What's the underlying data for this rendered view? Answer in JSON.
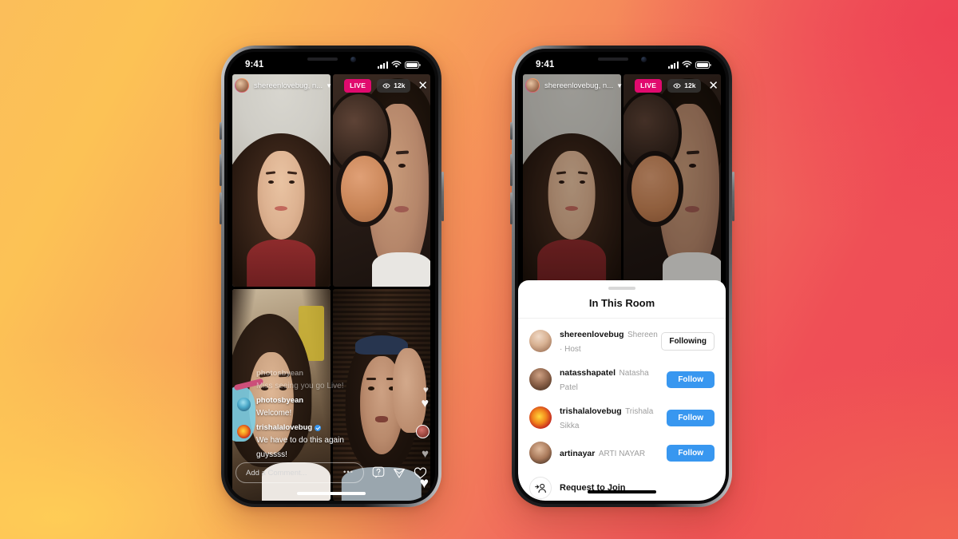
{
  "background": {
    "gradient_from": "#fbbe5a",
    "gradient_mid": "#f58a5a",
    "gradient_to": "#ee4a55"
  },
  "status_bar": {
    "time": "9:41",
    "signal_icon": "cellular-bars-icon",
    "wifi_icon": "wifi-icon",
    "battery_icon": "battery-icon"
  },
  "live": {
    "header": {
      "avatar_icon": "host-avatar",
      "title": "shereenlovebug, n...",
      "chevron_icon": "chevron-down-icon",
      "live_badge": "LIVE",
      "viewer_icon": "eye-icon",
      "viewer_count": "12k",
      "close_icon": "close-icon"
    },
    "comments": [
      {
        "user": "photosbyean",
        "text": "Miss seeing you go Live!",
        "verified": false,
        "faded": true
      },
      {
        "user": "photosbyean",
        "text": "Welcome!",
        "verified": false,
        "faded": false
      },
      {
        "user": "trishalalovebug",
        "text": "We have to do this again guyssss!",
        "verified": true,
        "faded": false
      }
    ],
    "bottom_bar": {
      "comment_placeholder": "Add a Comment...",
      "more_icon": "ellipsis-icon",
      "question_icon": "question-box-icon",
      "share_icon": "paper-plane-icon",
      "like_icon": "heart-icon"
    },
    "hearts_icon": "floating-hearts"
  },
  "sheet": {
    "grabber_icon": "sheet-grabber",
    "title": "In This Room",
    "participants": [
      {
        "username": "shereenlovebug",
        "fullname": "Shereen · Host",
        "action": "Following",
        "action_style": "following",
        "avatar": "av-shereen"
      },
      {
        "username": "natasshapatel",
        "fullname": "Natasha Patel",
        "action": "Follow",
        "action_style": "follow",
        "avatar": "av-natassha"
      },
      {
        "username": "trishalalovebug",
        "fullname": "Trishala Sikka",
        "action": "Follow",
        "action_style": "follow",
        "avatar": "av-trishala"
      },
      {
        "username": "artinayar",
        "fullname": "ARTI NAYAR",
        "action": "Follow",
        "action_style": "follow",
        "avatar": "av-arti"
      }
    ],
    "request": {
      "icon": "add-person-icon",
      "label": "Request to Join"
    },
    "accent_color": "#3897f0"
  }
}
